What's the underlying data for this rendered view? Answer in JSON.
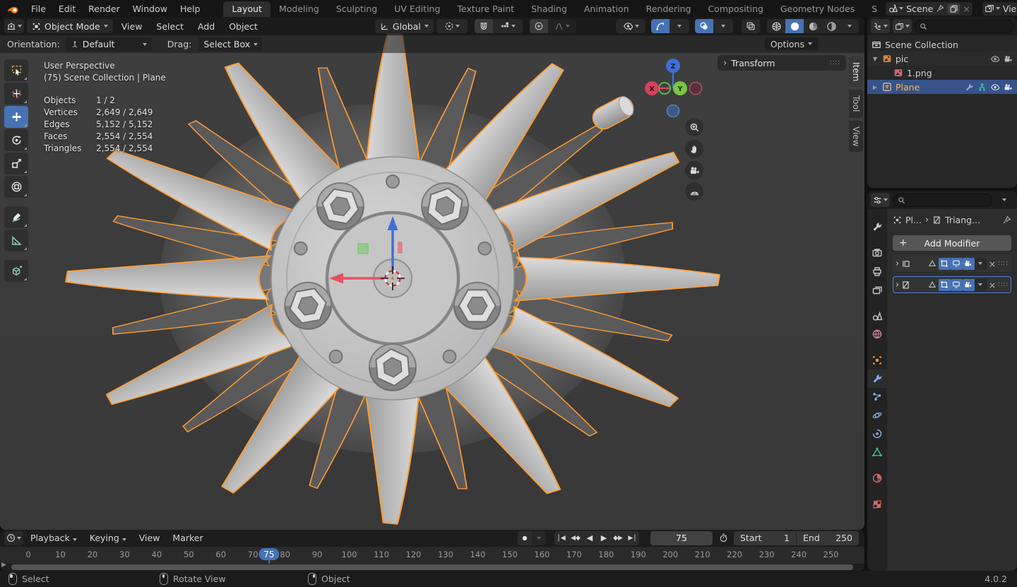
{
  "topbar": {
    "menus": [
      "File",
      "Edit",
      "Render",
      "Window",
      "Help"
    ],
    "tabs": [
      {
        "label": "Layout",
        "active": true
      },
      {
        "label": "Modeling"
      },
      {
        "label": "Sculpting"
      },
      {
        "label": "UV Editing"
      },
      {
        "label": "Texture Paint"
      },
      {
        "label": "Shading"
      },
      {
        "label": "Animation"
      },
      {
        "label": "Rendering"
      },
      {
        "label": "Compositing"
      },
      {
        "label": "Geometry Nodes"
      },
      {
        "label": "S"
      }
    ],
    "scene": {
      "value": "Scene"
    },
    "view_layer": {
      "value": "ViewLayer"
    }
  },
  "viewport": {
    "header": {
      "mode": "Object Mode",
      "menus": [
        "View",
        "Select",
        "Add",
        "Object"
      ],
      "orientation": "Global"
    },
    "tool_settings": {
      "orientation_label": "Orientation:",
      "orientation_value": "Default",
      "drag_label": "Drag:",
      "drag_value": "Select Box",
      "options": "Options"
    },
    "stats": {
      "view": "User Perspective",
      "context": "(75) Scene Collection | Plane",
      "rows": [
        [
          "Objects",
          "1 / 2"
        ],
        [
          "Vertices",
          "2,649 / 2,649"
        ],
        [
          "Edges",
          "5,152 / 5,152"
        ],
        [
          "Faces",
          "2,554 / 2,554"
        ],
        [
          "Triangles",
          "2,554 / 2,554"
        ]
      ]
    },
    "axis_labels": {
      "x": "X",
      "y": "Y",
      "z": "Z"
    },
    "sidebar": {
      "panel": "Transform",
      "tabs": [
        {
          "label": "Item",
          "active": true
        },
        {
          "label": "Tool"
        },
        {
          "label": "View"
        }
      ]
    },
    "tools": [
      {
        "name": "select-box"
      },
      {
        "name": "cursor"
      },
      {
        "name": "move",
        "active": true
      },
      {
        "name": "rotate"
      },
      {
        "name": "scale"
      },
      {
        "name": "transform"
      },
      {
        "name": "annotate",
        "gap": true
      },
      {
        "name": "measure"
      },
      {
        "name": "add-cube",
        "gap": true
      }
    ]
  },
  "outliner": {
    "search_placeholder": "",
    "items": [
      {
        "label": "Scene Collection"
      },
      {
        "label": "pic"
      },
      {
        "label": "1.png"
      },
      {
        "label": "Plane",
        "selected": true
      }
    ]
  },
  "properties": {
    "tabs": [
      {
        "name": "tool",
        "color": "#c9c9c9"
      },
      {
        "name": "render",
        "color": "#c9c9c9",
        "gap": true
      },
      {
        "name": "output",
        "color": "#c9c9c9"
      },
      {
        "name": "view-layer",
        "color": "#c9c9c9"
      },
      {
        "name": "scene",
        "color": "#c9c9c9",
        "gap": true
      },
      {
        "name": "world",
        "color": "#cf8797"
      },
      {
        "name": "object",
        "color": "#e8973f",
        "gap": true
      },
      {
        "name": "modifiers",
        "color": "#7fb0ec",
        "active": true
      },
      {
        "name": "particles",
        "color": "#7fb0ec"
      },
      {
        "name": "physics",
        "color": "#7fb0ec"
      },
      {
        "name": "constraints",
        "color": "#7fb0ec"
      },
      {
        "name": "data",
        "color": "#49c28f"
      },
      {
        "name": "material",
        "color": "#d16a6a",
        "gap": true
      },
      {
        "name": "texture",
        "color": "#d16a6a",
        "gap": true
      }
    ],
    "breadcrumb": {
      "object": "Pl...",
      "modifier": "Triang..."
    },
    "add_modifier": "Add Modifier"
  },
  "timeline": {
    "menus": [
      "Playback",
      "Keying",
      "View",
      "Marker"
    ],
    "frame": "75",
    "start_label": "Start",
    "start_value": "1",
    "end_label": "End",
    "end_value": "250"
  },
  "ruler": {
    "tick_start": 0,
    "tick_end": 250,
    "tick_step": 10,
    "current": 75
  },
  "status_bar": {
    "hints": [
      {
        "label": "Select"
      },
      {
        "label": "Rotate View"
      },
      {
        "label": "Object"
      }
    ],
    "version": "4.0.2"
  },
  "colors": {
    "accent": "#4772b3",
    "selection_outline": "#ff9c33",
    "active_object_text": "#ffb441"
  }
}
